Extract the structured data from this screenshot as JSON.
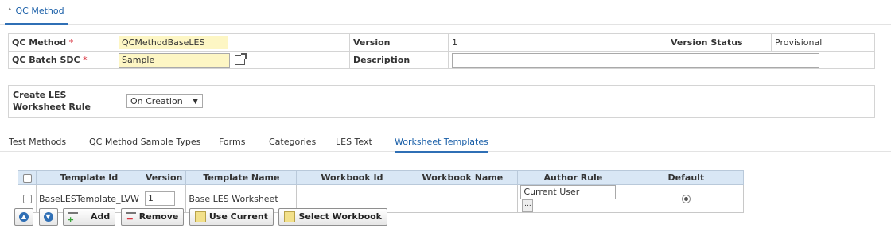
{
  "section": {
    "title": "QC Method",
    "chevron": "chevron-up-icon"
  },
  "form": {
    "qc_method_label": "QC Method",
    "qc_method_value": "QCMethodBaseLES",
    "version_label": "Version",
    "version_value": "1",
    "version_status_label": "Version Status",
    "version_status_value": "Provisional",
    "qc_batch_sdc_label": "QC Batch SDC",
    "qc_batch_sdc_value": "Sample",
    "description_label": "Description",
    "description_value": "",
    "required_marker": "*"
  },
  "rule": {
    "label": "Create LES Worksheet Rule",
    "selected": "On Creation"
  },
  "tabs": [
    {
      "label": "Test Methods"
    },
    {
      "label": "QC Method Sample Types"
    },
    {
      "label": "Forms"
    },
    {
      "label": "Categories"
    },
    {
      "label": "LES Text"
    },
    {
      "label": "Worksheet Templates"
    }
  ],
  "active_tab": "Worksheet Templates",
  "grid": {
    "headers": [
      "Template Id",
      "Version",
      "Template Name",
      "Workbook Id",
      "Workbook Name",
      "Author Rule",
      "Default"
    ],
    "rows": [
      {
        "template_id": "BaseLESTemplate_LVW",
        "version": "1",
        "template_name": "Base LES Worksheet",
        "workbook_id": "",
        "workbook_name": "",
        "author_rule": "Current User",
        "default_selected": true
      }
    ]
  },
  "buttons": {
    "move_up_icon": "arrow-up-icon",
    "move_down_icon": "arrow-down-icon",
    "add_label": "Add",
    "remove_label": "Remove",
    "use_current_label": "Use Current",
    "select_workbook_label": "Select Workbook"
  },
  "colors": {
    "accent": "#2f6fb5",
    "required": "#d9333f",
    "highlight_field": "#fdf6c4",
    "grid_header": "#d9e7f5"
  }
}
